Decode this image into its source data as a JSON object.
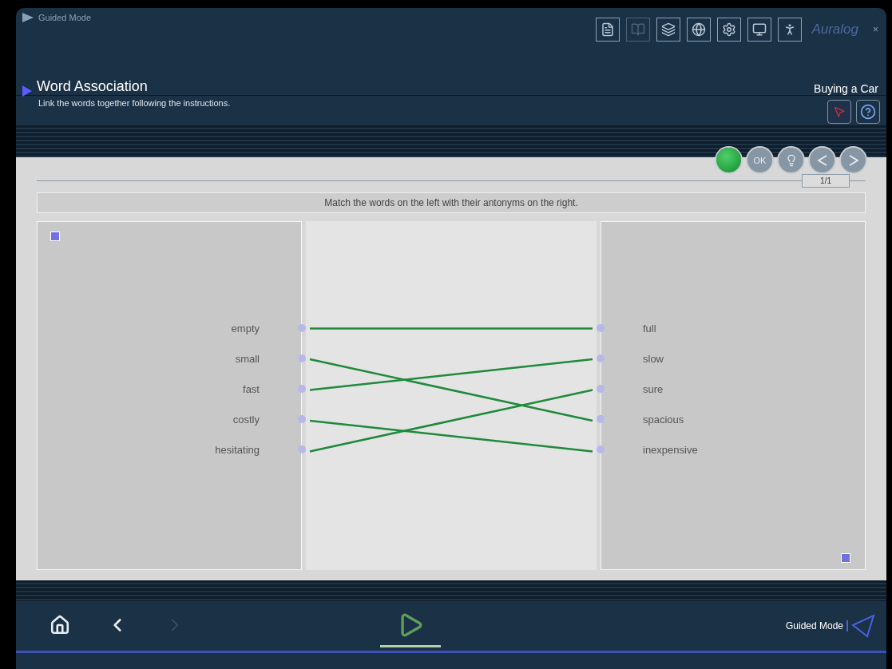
{
  "window": {
    "mode": "Guided Mode",
    "close": "×",
    "logo": "Auralog"
  },
  "toolbar": [
    {
      "kind": "notes",
      "disabled": false
    },
    {
      "kind": "book",
      "disabled": true
    },
    {
      "kind": "cards",
      "disabled": false
    },
    {
      "kind": "globe",
      "disabled": false
    },
    {
      "kind": "settings",
      "disabled": false
    },
    {
      "kind": "computer",
      "disabled": false
    },
    {
      "kind": "walker",
      "disabled": false
    }
  ],
  "header": {
    "title": "Word Association",
    "subtitle": "Link the words together following the instructions.",
    "lesson": "Buying a Car"
  },
  "actions": [
    {
      "kind": "status",
      "on": true
    },
    {
      "kind": "ok",
      "label": "OK"
    },
    {
      "kind": "hint"
    },
    {
      "kind": "previous"
    },
    {
      "kind": "next"
    }
  ],
  "counter": "1/1",
  "instruction": "Match the words on the left with their antonyms on the right.",
  "left_words": [
    "empty",
    "small",
    "fast",
    "costly",
    "hesitating"
  ],
  "right_words": [
    "full",
    "slow",
    "sure",
    "spacious",
    "inexpensive"
  ],
  "bottom_nav": [
    {
      "kind": "home",
      "disabled": false,
      "selected": false
    },
    {
      "kind": "back",
      "disabled": false,
      "selected": false
    },
    {
      "kind": "forward",
      "disabled": true,
      "selected": false
    },
    {
      "kind": "exercise",
      "disabled": false,
      "selected": true
    }
  ],
  "mode_label": "Guided Mode"
}
